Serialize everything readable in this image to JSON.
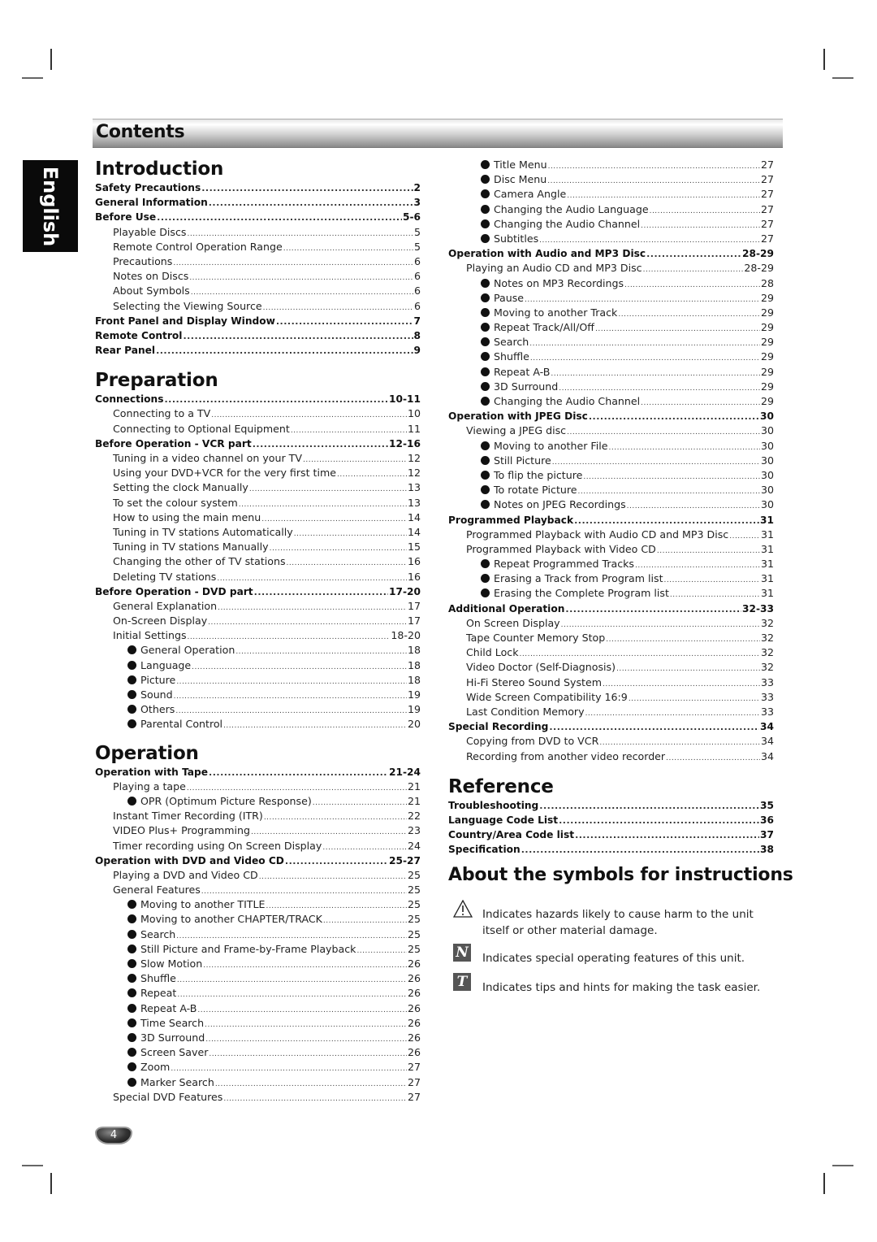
{
  "header": {
    "title": "Contents"
  },
  "language_tab": "English",
  "left_column": [
    {
      "section": "Introduction",
      "entries": [
        {
          "level": 0,
          "label": "Safety Precautions",
          "page": "2"
        },
        {
          "level": 0,
          "label": "General Information",
          "page": "3"
        },
        {
          "level": 0,
          "label": "Before Use",
          "page": "5-6"
        },
        {
          "level": 1,
          "label": "Playable Discs",
          "page": "5"
        },
        {
          "level": 1,
          "label": "Remote Control Operation Range",
          "page": "5"
        },
        {
          "level": 1,
          "label": "Precautions",
          "page": "6"
        },
        {
          "level": 1,
          "label": "Notes on Discs",
          "page": "6"
        },
        {
          "level": 1,
          "label": "About Symbols",
          "page": "6"
        },
        {
          "level": 1,
          "label": "Selecting the Viewing Source",
          "page": "6"
        },
        {
          "level": 0,
          "label": "Front Panel and Display Window",
          "page": "7"
        },
        {
          "level": 0,
          "label": "Remote Control",
          "page": "8"
        },
        {
          "level": 0,
          "label": "Rear Panel",
          "page": "9"
        }
      ]
    },
    {
      "section": "Preparation",
      "entries": [
        {
          "level": 0,
          "label": "Connections",
          "page": "10-11"
        },
        {
          "level": 1,
          "label": "Connecting to a TV",
          "page": "10"
        },
        {
          "level": 1,
          "label": "Connecting to Optional Equipment",
          "page": "11"
        },
        {
          "level": 0,
          "label": "Before Operation - VCR part",
          "page": "12-16"
        },
        {
          "level": 1,
          "label": "Tuning in a video channel on your TV",
          "page": "12"
        },
        {
          "level": 1,
          "label": "Using your DVD+VCR for the very first time",
          "page": "12"
        },
        {
          "level": 1,
          "label": "Setting the clock Manually",
          "page": "13"
        },
        {
          "level": 1,
          "label": "To set the colour system",
          "page": "13"
        },
        {
          "level": 1,
          "label": "How to using the main menu",
          "page": "14"
        },
        {
          "level": 1,
          "label": "Tuning in TV stations Automatically",
          "page": "14"
        },
        {
          "level": 1,
          "label": "Tuning in TV stations Manually",
          "page": "15"
        },
        {
          "level": 1,
          "label": "Changing the other of TV stations",
          "page": "16"
        },
        {
          "level": 1,
          "label": "Deleting TV stations",
          "page": "16"
        },
        {
          "level": 0,
          "label": "Before Operation - DVD part",
          "page": "17-20"
        },
        {
          "level": 1,
          "label": "General Explanation",
          "page": "17"
        },
        {
          "level": 1,
          "label": "On-Screen Display",
          "page": "17"
        },
        {
          "level": 1,
          "label": "Initial Settings",
          "page": "18-20"
        },
        {
          "level": 2,
          "label": "General Operation",
          "page": "18"
        },
        {
          "level": 2,
          "label": "Language",
          "page": "18"
        },
        {
          "level": 2,
          "label": "Picture",
          "page": "18"
        },
        {
          "level": 2,
          "label": "Sound",
          "page": "19"
        },
        {
          "level": 2,
          "label": "Others",
          "page": "19"
        },
        {
          "level": 2,
          "label": "Parental Control",
          "page": "20"
        }
      ]
    },
    {
      "section": "Operation",
      "entries": [
        {
          "level": 0,
          "label": "Operation with Tape",
          "page": "21-24"
        },
        {
          "level": 1,
          "label": "Playing a tape",
          "page": "21"
        },
        {
          "level": 2,
          "label": "OPR (Optimum Picture Response)",
          "page": "21"
        },
        {
          "level": 1,
          "label": "Instant Timer Recording (ITR)",
          "page": "22"
        },
        {
          "level": 1,
          "label": "VIDEO Plus+ Programming",
          "page": "23"
        },
        {
          "level": 1,
          "label": "Timer recording using On Screen Display",
          "page": "24"
        },
        {
          "level": 0,
          "label": "Operation with DVD and Video CD",
          "page": "25-27"
        },
        {
          "level": 1,
          "label": "Playing a DVD and Video CD",
          "page": "25"
        },
        {
          "level": 1,
          "label": "General Features",
          "page": "25"
        },
        {
          "level": 2,
          "label": "Moving to another TITLE",
          "page": "25"
        },
        {
          "level": 2,
          "label": "Moving to another CHAPTER/TRACK",
          "page": "25"
        },
        {
          "level": 2,
          "label": "Search",
          "page": "25"
        },
        {
          "level": 2,
          "label": "Still Picture and Frame-by-Frame Playback",
          "page": "25"
        },
        {
          "level": 2,
          "label": "Slow Motion",
          "page": "26"
        },
        {
          "level": 2,
          "label": "Shuffle",
          "page": "26"
        },
        {
          "level": 2,
          "label": "Repeat",
          "page": "26"
        },
        {
          "level": 2,
          "label": "Repeat A-B",
          "page": "26"
        },
        {
          "level": 2,
          "label": "Time Search",
          "page": "26"
        },
        {
          "level": 2,
          "label": "3D Surround",
          "page": "26"
        },
        {
          "level": 2,
          "label": "Screen Saver",
          "page": "26"
        },
        {
          "level": 2,
          "label": "Zoom",
          "page": "27"
        },
        {
          "level": 2,
          "label": "Marker Search",
          "page": "27"
        },
        {
          "level": 1,
          "label": "Special DVD Features",
          "page": "27"
        }
      ]
    }
  ],
  "right_column": [
    {
      "section": "",
      "entries": [
        {
          "level": 2,
          "label": "Title Menu",
          "page": "27"
        },
        {
          "level": 2,
          "label": "Disc Menu",
          "page": "27"
        },
        {
          "level": 2,
          "label": "Camera Angle",
          "page": "27"
        },
        {
          "level": 2,
          "label": "Changing the Audio Language",
          "page": "27"
        },
        {
          "level": 2,
          "label": "Changing the Audio Channel",
          "page": "27"
        },
        {
          "level": 2,
          "label": "Subtitles",
          "page": "27"
        },
        {
          "level": 0,
          "label": "Operation with Audio and MP3 Disc",
          "page": "28-29"
        },
        {
          "level": 1,
          "label": "Playing an Audio CD and MP3 Disc",
          "page": "28-29"
        },
        {
          "level": 2,
          "label": "Notes on MP3 Recordings",
          "page": "28"
        },
        {
          "level": 2,
          "label": "Pause",
          "page": "29"
        },
        {
          "level": 2,
          "label": "Moving to another Track",
          "page": "29"
        },
        {
          "level": 2,
          "label": "Repeat Track/All/Off",
          "page": "29"
        },
        {
          "level": 2,
          "label": "Search",
          "page": "29"
        },
        {
          "level": 2,
          "label": "Shuffle",
          "page": "29"
        },
        {
          "level": 2,
          "label": "Repeat A-B",
          "page": "29"
        },
        {
          "level": 2,
          "label": "3D Surround",
          "page": "29"
        },
        {
          "level": 2,
          "label": "Changing the Audio Channel",
          "page": "29"
        },
        {
          "level": 0,
          "label": "Operation with JPEG Disc",
          "page": "30"
        },
        {
          "level": 1,
          "label": "Viewing a JPEG disc",
          "page": "30"
        },
        {
          "level": 2,
          "label": "Moving to another File",
          "page": "30"
        },
        {
          "level": 2,
          "label": "Still Picture",
          "page": "30"
        },
        {
          "level": 2,
          "label": "To flip the picture",
          "page": "30"
        },
        {
          "level": 2,
          "label": "To rotate Picture",
          "page": "30"
        },
        {
          "level": 2,
          "label": "Notes on JPEG Recordings",
          "page": "30"
        },
        {
          "level": 0,
          "label": "Programmed Playback",
          "page": "31"
        },
        {
          "level": 1,
          "label": "Programmed Playback with Audio CD and MP3 Disc",
          "page": "31"
        },
        {
          "level": 1,
          "label": "Programmed Playback with Video CD",
          "page": "31"
        },
        {
          "level": 2,
          "label": "Repeat Programmed Tracks",
          "page": "31"
        },
        {
          "level": 2,
          "label": "Erasing a Track from Program list",
          "page": "31"
        },
        {
          "level": 2,
          "label": "Erasing the Complete Program list",
          "page": "31"
        },
        {
          "level": 0,
          "label": "Additional Operation",
          "page": "32-33"
        },
        {
          "level": 1,
          "label": "On Screen Display",
          "page": "32"
        },
        {
          "level": 1,
          "label": "Tape Counter Memory Stop",
          "page": "32"
        },
        {
          "level": 1,
          "label": "Child Lock",
          "page": "32"
        },
        {
          "level": 1,
          "label": "Video Doctor (Self-Diagnosis)",
          "page": "32"
        },
        {
          "level": 1,
          "label": "Hi-Fi Stereo Sound System",
          "page": "33"
        },
        {
          "level": 1,
          "label": "Wide Screen Compatibility 16:9",
          "page": "33"
        },
        {
          "level": 1,
          "label": "Last Condition Memory",
          "page": "33"
        },
        {
          "level": 0,
          "label": "Special Recording",
          "page": "34"
        },
        {
          "level": 1,
          "label": "Copying from DVD to VCR",
          "page": "34"
        },
        {
          "level": 1,
          "label": "Recording from another video recorder",
          "page": "34"
        }
      ]
    },
    {
      "section": "Reference",
      "entries": [
        {
          "level": 0,
          "label": "Troubleshooting",
          "page": "35"
        },
        {
          "level": 0,
          "label": "Language Code List",
          "page": "36"
        },
        {
          "level": 0,
          "label": "Country/Area Code list",
          "page": "37"
        },
        {
          "level": 0,
          "label": "Specification",
          "page": "38"
        }
      ]
    }
  ],
  "symbols": {
    "title": "About the symbols for instructions",
    "items": [
      {
        "icon": "warning-triangle-icon",
        "glyph": "⚠",
        "text": "Indicates hazards likely to cause harm to the unit itself or other material damage."
      },
      {
        "icon": "note-n-icon",
        "glyph": "N",
        "text": "Indicates special operating features of this unit."
      },
      {
        "icon": "tip-t-icon",
        "glyph": "T",
        "text": "Indicates tips and hints for making the task easier."
      }
    ]
  },
  "page_number": "4"
}
